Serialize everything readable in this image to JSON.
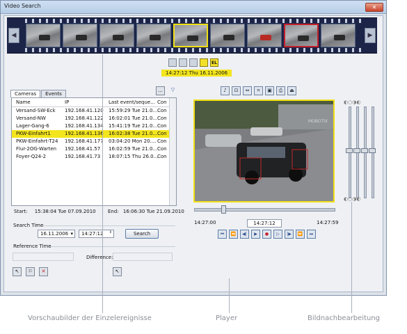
{
  "window": {
    "title": "Video Search",
    "close_glyph": "✕"
  },
  "film": {
    "left_arrow": "◀",
    "right_arrow": "▶"
  },
  "strip_buttons": [
    "",
    "",
    "",
    "",
    "EL"
  ],
  "strip_timestamp": "14:27:12 Thu 16.11.2006",
  "left": {
    "tabs": [
      "Cameras",
      "Events"
    ],
    "more_button": "...",
    "filter_icon": "filter-icon",
    "columns": [
      "Name",
      "IP",
      "Last event/seque...",
      "Con"
    ],
    "rows": [
      [
        "Versand-SW-Eck",
        "192.168.41.120",
        "15:59:29 Tue 21.0...",
        "Con"
      ],
      [
        "Versand-NW",
        "192.168.41.122",
        "16:02:01 Tue 21.0...",
        "Con"
      ],
      [
        "Lager-Gang-6",
        "192.168.41.134",
        "15:41:19 Tue 21.0...",
        "Con"
      ],
      [
        "PKW-Einfahrt1",
        "192.168.41.136",
        "16:02:38 Tue 21.0...",
        "Con"
      ],
      [
        "PKW-Einfahrt-T24",
        "192.168.41.177",
        "03:04:20 Mon 20....",
        "Con"
      ],
      [
        "Flur-2OG-Warten",
        "192.168.41.57",
        "16:02:59 Tue 21.0...",
        "Con"
      ],
      [
        "Foyer-Q24-2",
        "192.168.41.73",
        "18:07:15 Thu 26.0...",
        "Con"
      ]
    ],
    "selected_row_index": 3,
    "start_label": "Start:",
    "start_value": "15:38:04 Tue 07.09.2010",
    "end_label": "End:",
    "end_value": "16:06:30 Tue 21.09.2010",
    "search_time_label": "Search Time",
    "search_date": "16.11.2006",
    "search_time": "14:27:12",
    "search_button": "Search",
    "reference_time_label": "Reference Time",
    "difference_label": "Difference:"
  },
  "player": {
    "toolbar_icons": [
      "speaker-icon",
      "zoom-icon",
      "fit-icon",
      "crop-icon",
      "save-icon",
      "print-icon",
      "eject-icon"
    ],
    "time_start": "14:27:00",
    "time_current": "14:27:12",
    "time_end": "14:27:59",
    "controls": [
      "⏮",
      "⏪",
      "◀|",
      "▶",
      "●",
      "▷",
      "|▶",
      "⏩",
      "⏭"
    ],
    "watermark": "MOBOTIX"
  },
  "captions": {
    "thumbnails": "Vorschaubilder der  Einzelereignisse",
    "player": "Player",
    "postprocessing": "Bildnachbearbeitung"
  }
}
